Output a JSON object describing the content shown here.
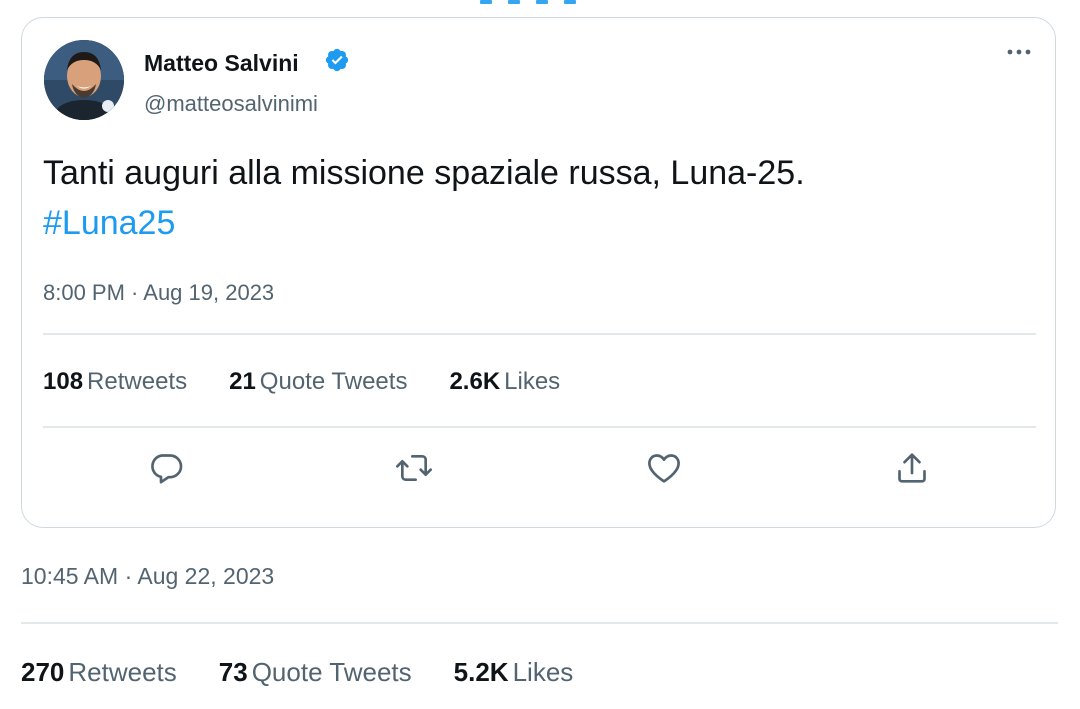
{
  "tweet": {
    "author_name": "Matteo Salvini",
    "author_handle": "@matteosalvinimi",
    "text": "Tanti auguri alla missione spaziale russa, Luna-25.",
    "hashtag": "#Luna25",
    "timestamp": "8:00 PM · Aug 19, 2023",
    "verified": true,
    "stats": [
      {
        "count": "108",
        "label": "Retweets"
      },
      {
        "count": "21",
        "label": "Quote Tweets"
      },
      {
        "count": "2.6K",
        "label": "Likes"
      }
    ],
    "actions": [
      {
        "icon": "reply-icon"
      },
      {
        "icon": "retweet-icon"
      },
      {
        "icon": "like-icon"
      },
      {
        "icon": "share-icon"
      }
    ]
  },
  "outer": {
    "timestamp": "10:45 AM · Aug 22, 2023",
    "stats": [
      {
        "count": "270",
        "label": "Retweets"
      },
      {
        "count": "73",
        "label": "Quote Tweets"
      },
      {
        "count": "5.2K",
        "label": "Likes"
      }
    ]
  },
  "colors": {
    "accent": "#1d9bf0",
    "text_primary": "#0f1419",
    "text_secondary": "#536471",
    "border": "#cfd9de"
  }
}
